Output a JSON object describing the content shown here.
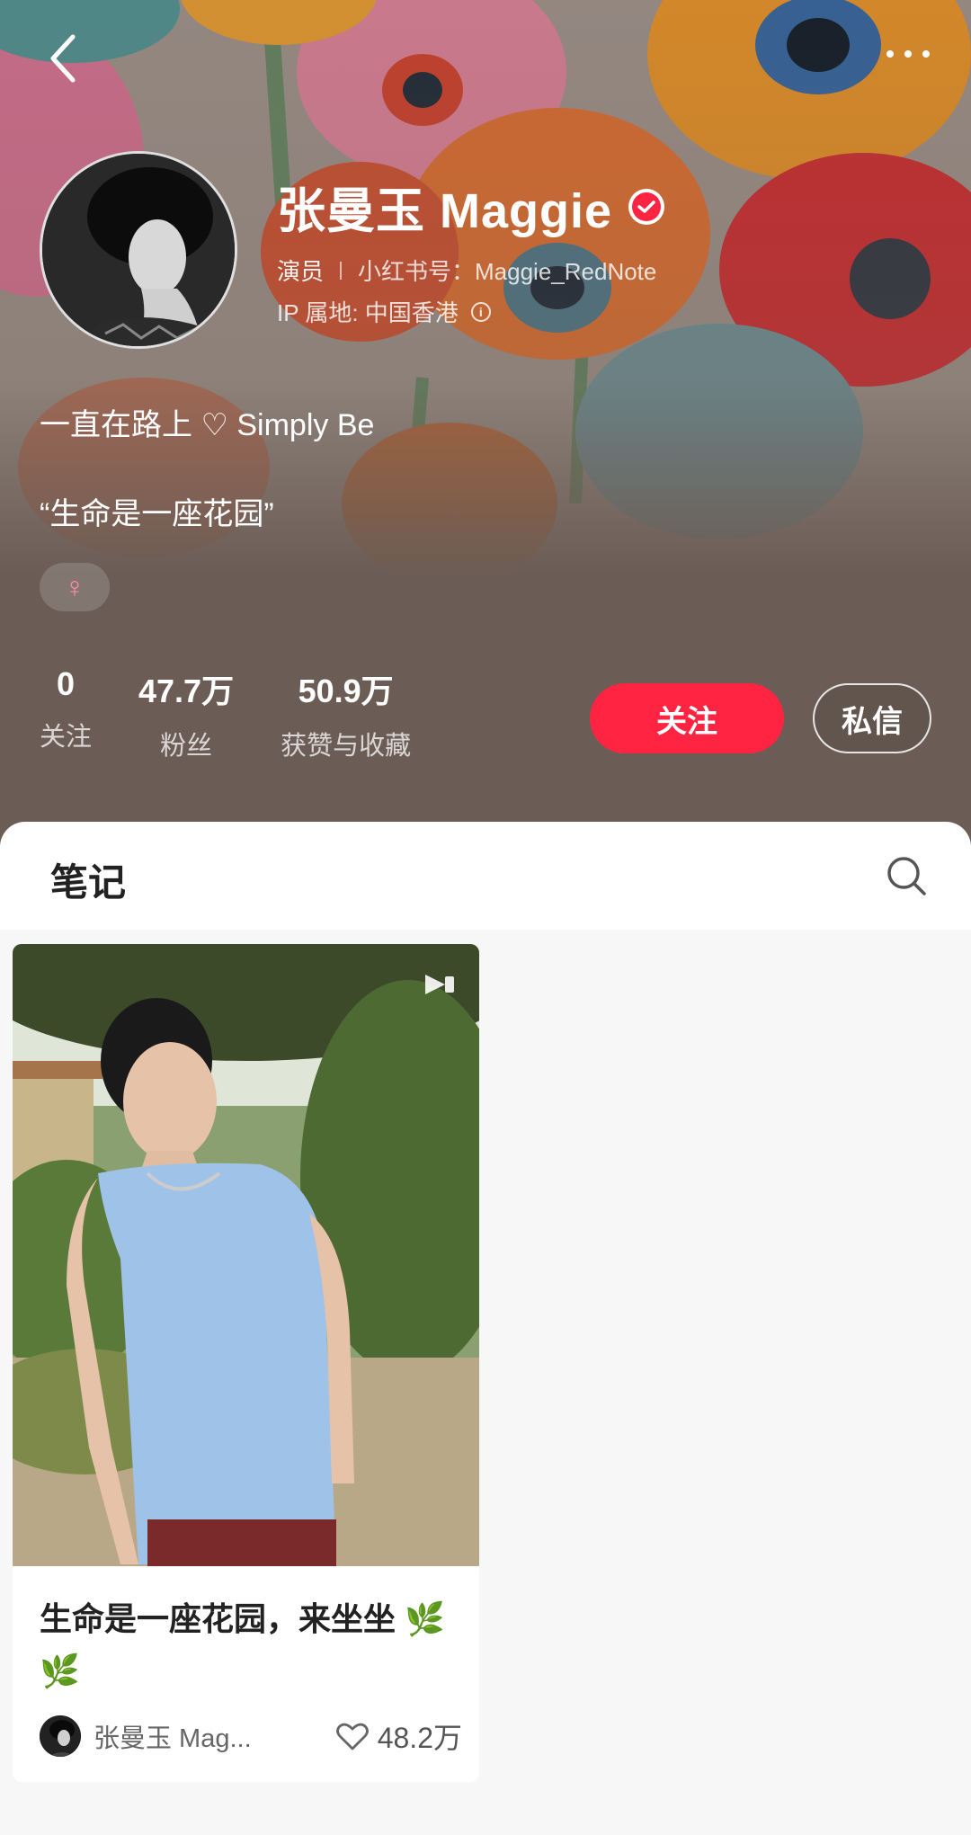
{
  "header": {
    "back_icon": "chevron-left-icon",
    "more_icon": "more-dots-icon"
  },
  "profile": {
    "name": "张曼玉 Maggie",
    "verified_icon": "verified-check-icon",
    "role": "演员",
    "redbook_id": "小红书号：Maggie_RedNote",
    "ip_location": "IP 属地: 中国香港",
    "bio_line1": "一直在路上 ♡ Simply Be",
    "bio_line2": "“生命是一座花园”",
    "gender_symbol": "♀"
  },
  "stats": [
    {
      "value": "0",
      "label": "关注"
    },
    {
      "value": "47.7万",
      "label": "粉丝"
    },
    {
      "value": "50.9万",
      "label": "获赞与收藏"
    }
  ],
  "actions": {
    "follow": "关注",
    "message": "私信"
  },
  "tabs": {
    "notes": "笔记"
  },
  "notes": [
    {
      "title": "生命是一座花园，来坐坐 🌿🌿",
      "author": "张曼玉 Mag...",
      "likes": "48.2万",
      "type": "video"
    }
  ],
  "colors": {
    "accent": "#ff2442",
    "header_bg": "#6b5d55"
  }
}
